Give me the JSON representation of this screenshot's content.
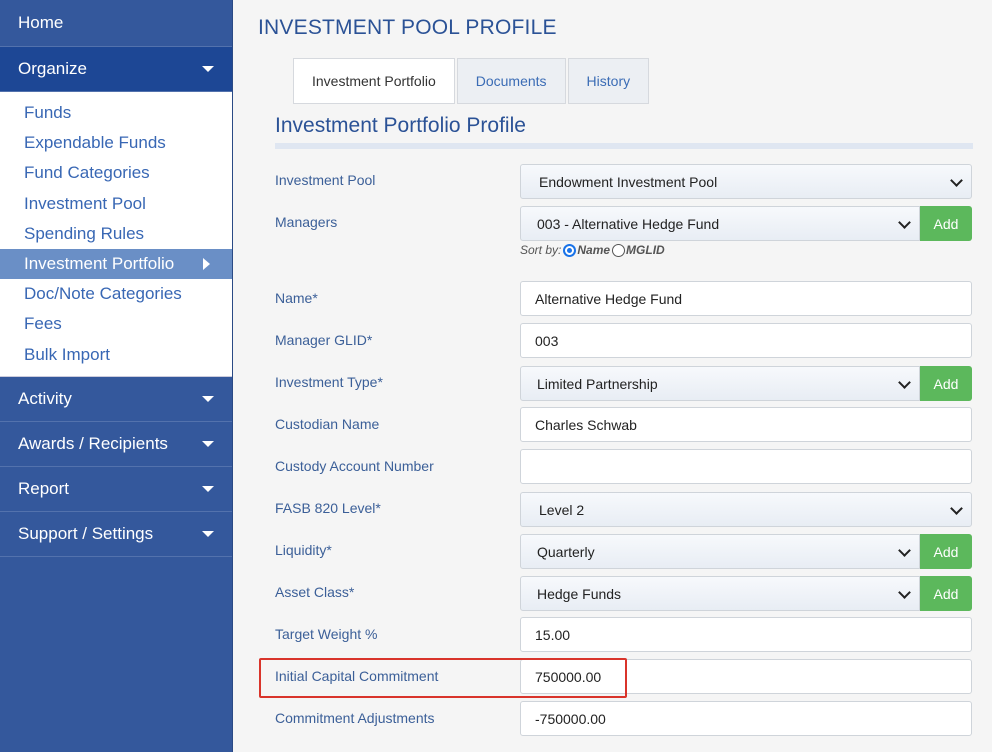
{
  "sidebar": {
    "home": "Home",
    "organize": "Organize",
    "organize_items": [
      "Funds",
      "Expendable Funds",
      "Fund Categories",
      "Investment Pool",
      "Spending Rules",
      "Investment Portfolio",
      "Doc/Note Categories",
      "Fees",
      "Bulk Import"
    ],
    "active_item": "Investment Portfolio",
    "activity": "Activity",
    "awards": "Awards / Recipients",
    "report": "Report",
    "support": "Support / Settings"
  },
  "page": {
    "title": "INVESTMENT POOL PROFILE",
    "tabs": [
      "Investment Portfolio",
      "Documents",
      "History"
    ],
    "active_tab": "Investment Portfolio",
    "section_title": "Investment Portfolio Profile"
  },
  "form": {
    "investment_pool": {
      "label": "Investment Pool",
      "value": "Endowment Investment Pool"
    },
    "managers": {
      "label": "Managers",
      "value": "003 - Alternative Hedge Fund",
      "add": "Add"
    },
    "sort_by": {
      "label": "Sort by:",
      "option1": "Name",
      "option2": "MGLID",
      "selected": "Name"
    },
    "name": {
      "label": "Name*",
      "value": "Alternative Hedge Fund"
    },
    "manager_glid": {
      "label": "Manager GLID*",
      "value": "003"
    },
    "investment_type": {
      "label": "Investment Type*",
      "value": "Limited Partnership",
      "add": "Add"
    },
    "custodian_name": {
      "label": "Custodian Name",
      "value": "Charles Schwab"
    },
    "custody_account_number": {
      "label": "Custody Account Number",
      "value": ""
    },
    "fasb_level": {
      "label": "FASB 820 Level*",
      "value": "Level 2"
    },
    "liquidity": {
      "label": "Liquidity*",
      "value": "Quarterly",
      "add": "Add"
    },
    "asset_class": {
      "label": "Asset Class*",
      "value": "Hedge Funds",
      "add": "Add"
    },
    "target_weight": {
      "label": "Target Weight %",
      "value": "15.00"
    },
    "initial_capital_commitment": {
      "label": "Initial Capital Commitment",
      "value": "750000.00"
    },
    "commitment_adjustments": {
      "label": "Commitment Adjustments",
      "value": "-750000.00"
    }
  },
  "colors": {
    "sidebar": "#34589c",
    "accent": "#2b5296",
    "add_button": "#5cb85c",
    "highlight": "#d9342b"
  }
}
